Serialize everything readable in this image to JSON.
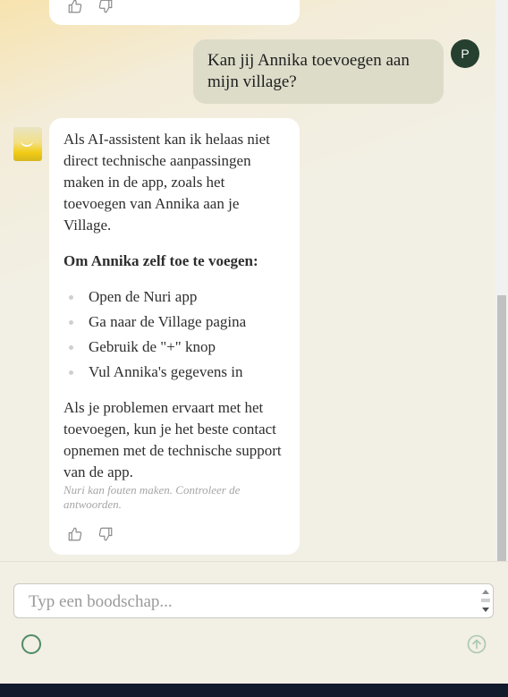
{
  "messages": {
    "user": {
      "avatar_initial": "P",
      "text": "Kan jij Annika toevoegen aan mijn village?"
    },
    "assistant": {
      "paragraph1": "Als AI-assistent kan ik helaas niet direct technische aanpassingen maken in de app, zoals het toevoegen van Annika aan je Village.",
      "heading": "Om Annika zelf toe te voegen:",
      "steps": [
        "Open de Nuri app",
        "Ga naar de Village pagina",
        "Gebruik de \"+\" knop",
        "Vul Annika's gegevens in"
      ],
      "paragraph2": "Als je problemen ervaart met het toevoegen, kun je het beste contact opnemen met de technische support van de app.",
      "disclaimer": "Nuri kan fouten maken. Controleer de antwoorden."
    }
  },
  "composer": {
    "placeholder": "Typ een boodschap..."
  },
  "icons": {
    "thumbs_up": "thumbs-up-icon",
    "thumbs_down": "thumbs-down-icon",
    "send": "arrow-up-circle-icon",
    "status": "circle-icon"
  },
  "colors": {
    "user_bubble": "#dddcc9",
    "user_avatar": "#25402f",
    "accent_green": "#4f8c64",
    "background": "#f2efe4"
  }
}
